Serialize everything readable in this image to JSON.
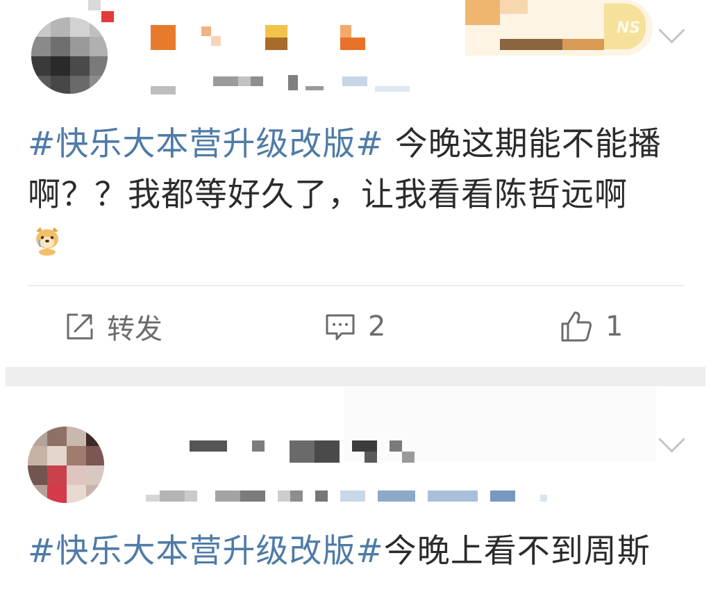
{
  "posts": [
    {
      "hashtag": "#快乐大本营升级改版#",
      "body": " 今晚这期能不能播啊？？我都等好久了，让我看看陈哲远啊",
      "emoji_icon": "dog-crying-emoji-icon",
      "actions": {
        "repost_label": "转发",
        "comment_count": "2",
        "like_count": "1"
      }
    },
    {
      "hashtag": "#快乐大本营升级改版#",
      "body": "今晚上看不到周斯"
    }
  ],
  "icons": {
    "repost": "share-icon",
    "comment": "comment-icon",
    "like": "thumbs-up-icon",
    "menu": "chevron-down-icon"
  },
  "colors": {
    "hashtag": "#4e7ba7",
    "text": "#2b2b2b",
    "action": "#6b6b6b",
    "separator": "#eeeeee"
  }
}
